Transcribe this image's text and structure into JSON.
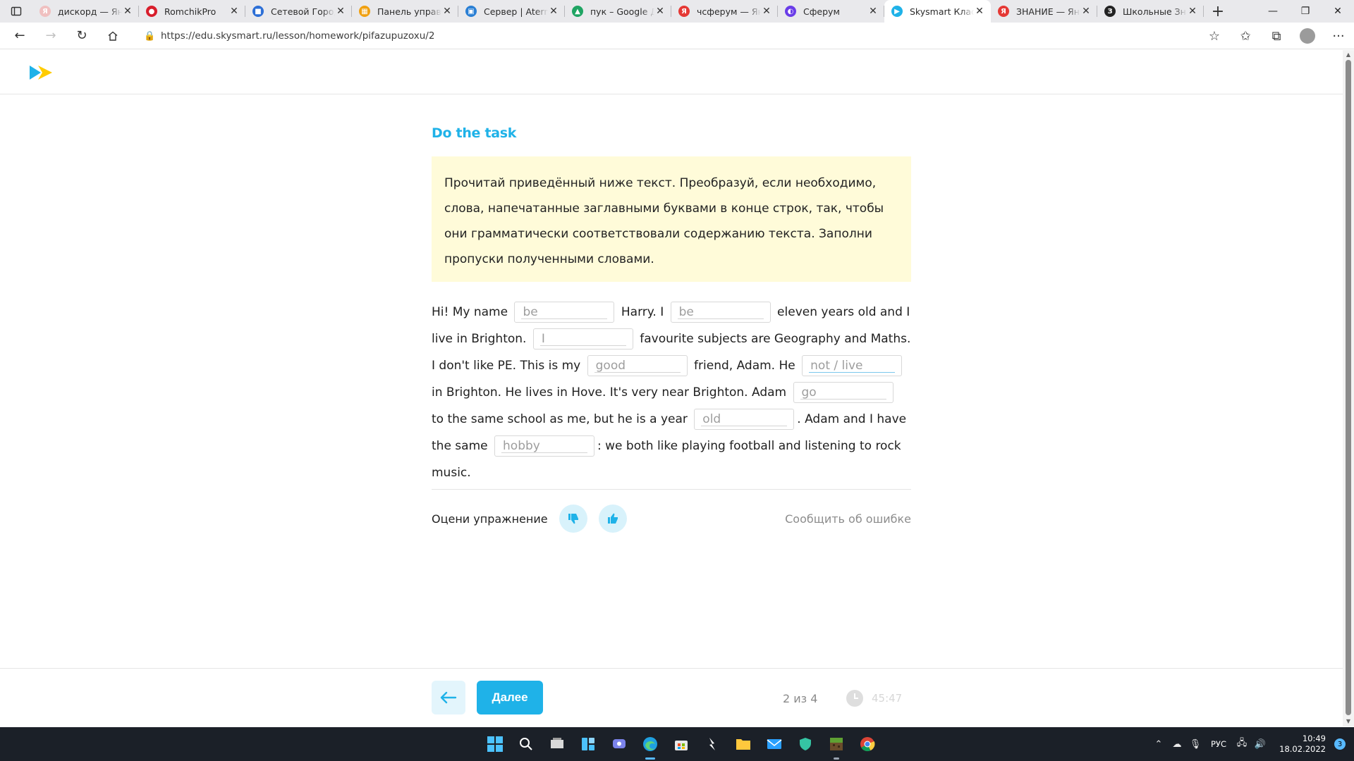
{
  "tabs": [
    {
      "title": "дискорд — Яндекс",
      "color": "#f0c0c0",
      "glyph": "Я"
    },
    {
      "title": "RomchikPro",
      "color": "#d81e2c",
      "glyph": "●"
    },
    {
      "title": "Сетевой Город",
      "color": "#2d6fd6",
      "glyph": "■"
    },
    {
      "title": "Панель управления",
      "color": "#f0a010",
      "glyph": "▦"
    },
    {
      "title": "Сервер | Aternos",
      "color": "#2a7fd4",
      "glyph": "▣"
    },
    {
      "title": "пук – Google Диск",
      "color": "#1fa463",
      "glyph": "▲"
    },
    {
      "title": "чсферум — Яндекс",
      "color": "#e53935",
      "glyph": "Я"
    },
    {
      "title": "Сферум",
      "color": "#6a3de8",
      "glyph": "◐"
    },
    {
      "title": "Skysmart Класс",
      "color": "#1fb2e8",
      "glyph": "▶"
    },
    {
      "title": "ЗНАНИЕ — Яндекс",
      "color": "#e53935",
      "glyph": "Я"
    },
    {
      "title": "Школьные Знания",
      "color": "#222222",
      "glyph": "З"
    }
  ],
  "address": {
    "url": "https://edu.skysmart.ru/lesson/homework/pifazupuzoxu/2"
  },
  "task": {
    "title": "Do the task",
    "instruction": "Прочитай приведённый ниже текст. Преобразуй, если необходимо, слова, напечатанные заглавными буквами в конце строк, так, чтобы они грамматически соответствовали содержанию текста. Заполни пропуски полученными словами."
  },
  "exercise": {
    "t1": "Hi! My name",
    "g1": "be",
    "t2": "Harry. I",
    "g2": "be",
    "t3": "eleven years old and I live in Brighton.",
    "g3": "I",
    "t4": "favourite subjects are Geography and Maths. I don't like PE. This is my",
    "g4": "good",
    "t5": "friend, Adam. He",
    "g5": "not / live",
    "t6": "in Brighton. He lives in Hove. It's very near Brighton. Adam",
    "g6": "go",
    "t7": "to the same school as me, but he is a year",
    "g7": "old",
    "t8": ". Adam and I have the same",
    "g8": "hobby",
    "t9": ": we both like playing football and listening to rock music."
  },
  "rating": {
    "label": "Оцени упражнение",
    "report": "Сообщить об ошибке"
  },
  "footer": {
    "next": "Далее",
    "progress": "2 из 4",
    "timer": "45:47"
  },
  "taskbar": {
    "lang": "РУС",
    "time": "10:49",
    "date": "18.02.2022",
    "notifications": "3"
  },
  "colors": {
    "accent": "#1fb2e8",
    "instruction_bg": "#fffbd9",
    "taskbar": "#1b2028"
  }
}
